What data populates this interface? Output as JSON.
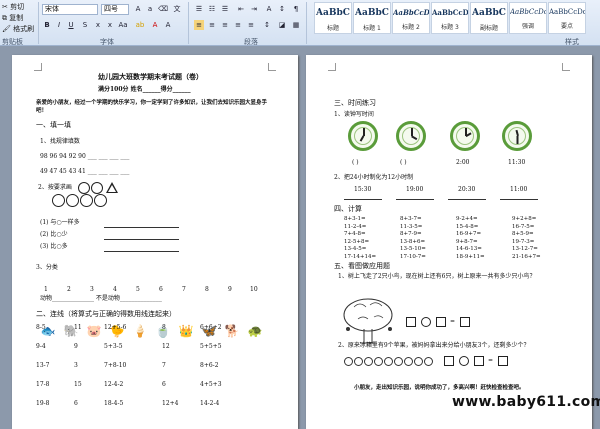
{
  "ribbon": {
    "clipboard": {
      "paste_label": "粘贴",
      "format_painter": "格式刷",
      "group": "剪贴板"
    },
    "font": {
      "name": "宋体",
      "size": "四号",
      "group": "字体"
    },
    "paragraph": {
      "group": "段落"
    },
    "styles": {
      "group": "样式",
      "items": [
        {
          "sample": "AaBbC",
          "name": "标题"
        },
        {
          "sample": "AaBbC",
          "name": "标题 1"
        },
        {
          "sample": "AaBbCcD",
          "name": "标题 2"
        },
        {
          "sample": "AaBbCcDd",
          "name": "标题 3"
        },
        {
          "sample": "AaBbC",
          "name": "副标题"
        },
        {
          "sample": "AaBbCcDc",
          "name": "强调"
        },
        {
          "sample": "AaBbCcDd",
          "name": "要点"
        },
        {
          "sample": "AaBbCcDc",
          "name": "正文"
        }
      ]
    }
  },
  "left_page": {
    "title": "幼儿园大班数学期末考试题（卷）",
    "score_line": "满分100分     姓名______得分______",
    "intro": "亲爱的小朋友，经过一个学期的快乐学习，你一定学到了许多知识，让我们去知识乐园大显身手吧！",
    "sec1": "一、填一填",
    "sec1_1": "1、找规律填数",
    "row1": "98  96  94  92  90 ___ ___ ___ ___",
    "row2": "49  47  45  43  41 ___ ___ ___ ___",
    "sec1_2": "2、按要求画",
    "q1": "(1) 与○一样多",
    "q2": "(2) 比○少",
    "q3": "(3) 比○多",
    "sec1_3": "3、分类",
    "nums": [
      "1",
      "2",
      "3",
      "4",
      "5",
      "6",
      "7",
      "8",
      "9",
      "10"
    ],
    "class_line": "动物______________   不是动物______________",
    "sec2": "二、连线（将算式与正确的得数用线连起来）",
    "match_rows": [
      [
        "8-5",
        "11",
        "12+5-6",
        "8",
        "6+6+2"
      ],
      [
        "9-4",
        "9",
        "5+3-5",
        "12",
        "5+5+5"
      ],
      [
        "13-7",
        "3",
        "7+8-10",
        "7",
        "8+6-2"
      ],
      [
        "17-8",
        "15",
        "12-4-2",
        "6",
        "4+5+3"
      ],
      [
        "19-8",
        "6",
        "18-4-5",
        "12+4",
        "14-2-4"
      ]
    ]
  },
  "right_page": {
    "sec3": "三、时间练习",
    "sec3_1": "1、读钟写时间",
    "clock_answers": [
      "(      )",
      "(      )",
      "2:00",
      "11:30"
    ],
    "sec3_2": "2、把24小时制化为12小时制",
    "times24": [
      "15:30",
      "19:00",
      "20:30",
      "11:00"
    ],
    "sec4": "四、计算",
    "calc_rows": [
      [
        "8+3-1=",
        "8+3-7=",
        "9-2+4=",
        "9+2+8="
      ],
      [
        "11-2-4=",
        "11-3-5=",
        "15-4-8=",
        "16-7-5="
      ],
      [
        "7+4-8=",
        "8+7-9=",
        "16-9+7=",
        "8+5-9="
      ],
      [
        "12-5+8=",
        "13-8+6=",
        "9+8-7=",
        "19-7-3="
      ],
      [
        "13-4-5=",
        "13-5-10=",
        "14-6-13=",
        "13-12-7="
      ],
      [
        "17-14+14=",
        "17-10-7=",
        "18-9+11=",
        "21-16+7="
      ]
    ],
    "sec5": "五、看图做应用题",
    "prob1": "1、树上飞走了2只小鸟，现在树上还有6只，树上原来一共有多少只小鸟？",
    "prob2": "2、原来冰箱里有9个苹果，被妈妈拿出来分给小朋友3个，还剩多少个？",
    "closing": "小朋友，走出知识乐园，说明你成功了，多高兴啊！赶快检查检查吧。"
  },
  "watermark": "www.baby611.com"
}
